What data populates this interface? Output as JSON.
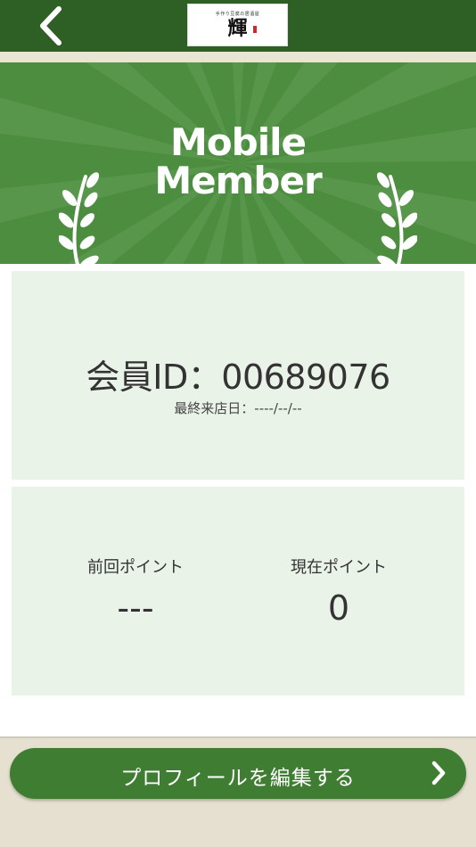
{
  "header": {
    "back_icon": "chevron-left-icon",
    "logo": {
      "tagline": "手作り豆腐の居酒屋",
      "mark": "輝"
    }
  },
  "banner": {
    "line1": "Mobile",
    "line2": "Member",
    "decor_icon": "laurel-icon"
  },
  "member": {
    "id_text": "会員ID：00689076",
    "last_visit": "最終来店日：----/--/--"
  },
  "points": {
    "previous": {
      "label": "前回ポイント",
      "value": "---"
    },
    "current": {
      "label": "現在ポイント",
      "value": "0"
    }
  },
  "footer": {
    "edit_profile_label": "プロフィールを編集する",
    "edit_icon": "chevron-right-icon"
  },
  "colors": {
    "header": "#2e5f24",
    "banner": "#4c8d3f",
    "card": "#eaf3e8",
    "button": "#3f7d33"
  }
}
